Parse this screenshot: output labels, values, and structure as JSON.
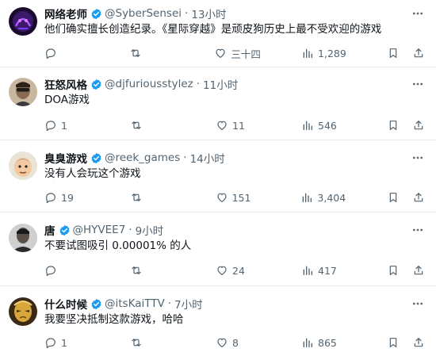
{
  "colors": {
    "verified": "#1d9bf0",
    "text": "#0f1419",
    "muted": "#536471",
    "divider": "#e6ecf0"
  },
  "tweets": [
    {
      "name": "网络老师",
      "handle": "@SyberSensei",
      "separator": "·",
      "time": "13小时",
      "text": "他们确实擅长创造纪录。《星际穿越》是顽皮狗历史上最不受欢迎的游戏",
      "replies": "",
      "retweets": "",
      "likes": "三十四",
      "views": "1,289",
      "avatar_icon": "purple-neon-avatar"
    },
    {
      "name": "狂怒风格",
      "handle": "@djfuriousstylez",
      "separator": "·",
      "time": "11小时",
      "text": "DOA游戏",
      "replies": "1",
      "retweets": "",
      "likes": "11",
      "views": "546",
      "avatar_icon": "sunglasses-man-avatar"
    },
    {
      "name": "臭臭游戏",
      "handle": "@reek_games",
      "separator": "·",
      "time": "14小时",
      "text": "没有人会玩这个游戏",
      "replies": "19",
      "retweets": "",
      "likes": "151",
      "views": "3,404",
      "avatar_icon": "cartoon-face-avatar"
    },
    {
      "name": "唐",
      "handle": "@HYVEE7",
      "separator": "·",
      "time": "9小时",
      "text": "不要试图吸引 0.00001% 的人",
      "replies": "",
      "retweets": "",
      "likes": "24",
      "views": "417",
      "avatar_icon": "dark-portrait-avatar"
    },
    {
      "name": "什么时候",
      "handle": "@itsKaiTTV",
      "separator": "·",
      "time": "7小时",
      "text": "我要坚决抵制这款游戏，哈哈",
      "replies": "1",
      "retweets": "",
      "likes": "8",
      "views": "865",
      "avatar_icon": "golden-mask-avatar"
    }
  ]
}
